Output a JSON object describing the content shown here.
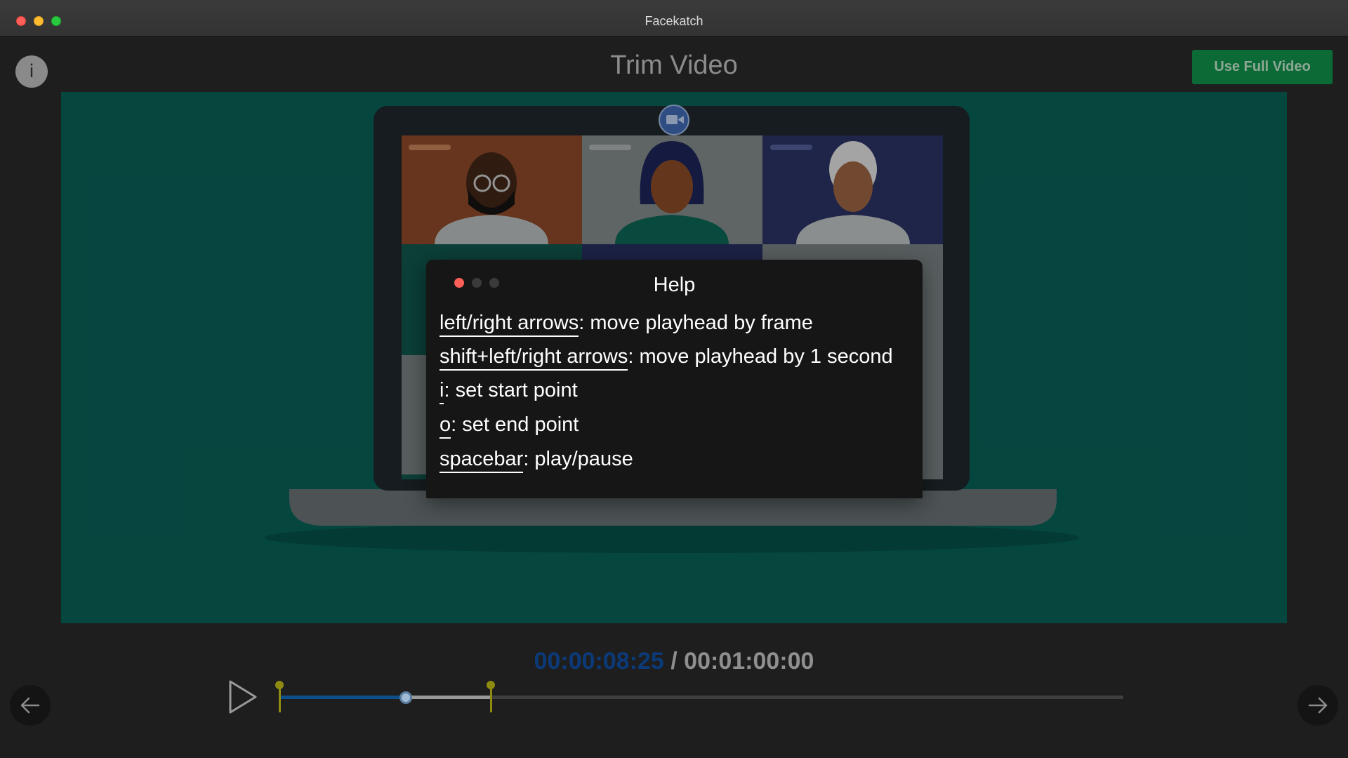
{
  "window": {
    "title": "Facekatch"
  },
  "header": {
    "info_label": "i",
    "title": "Trim Video",
    "use_full_video_label": "Use Full Video"
  },
  "help_dialog": {
    "title": "Help",
    "lines": [
      {
        "key": "left/right arrows",
        "desc": ": move playhead by frame"
      },
      {
        "key": "shift+left/right arrows",
        "desc": ": move playhead by 1 second"
      },
      {
        "key": "i",
        "desc": ": set start point"
      },
      {
        "key": "o",
        "desc": ": set end point"
      },
      {
        "key": "spacebar",
        "desc": ": play/pause"
      }
    ]
  },
  "transport": {
    "current_time": "00:00:08:25",
    "separator": " / ",
    "total_time": "00:01:00:00",
    "start_point_fraction": 0.0,
    "playhead_fraction": 0.15,
    "end_point_fraction": 0.25
  },
  "colors": {
    "video_bg": "#07564e",
    "accent_green": "#0c6a36",
    "timecode_current": "#0c3a78",
    "marker": "#8f8a10"
  },
  "icons": [
    "info-icon",
    "video-camera-icon",
    "play-icon",
    "arrow-left-icon",
    "arrow-right-icon"
  ]
}
